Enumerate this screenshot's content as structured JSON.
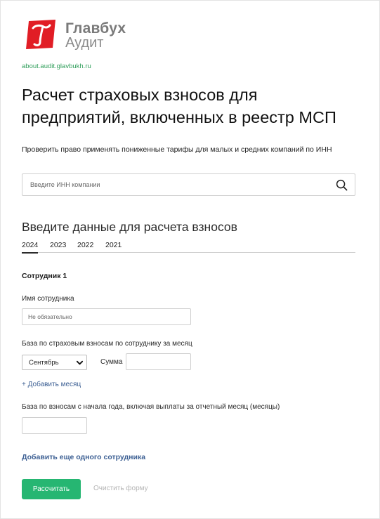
{
  "brand": {
    "name_line1": "Главбух",
    "name_line2": "Аудит",
    "logo_icon": "glavbukh-t-logo",
    "logo_color": "#e11d25"
  },
  "site_link": "about.audit.glavbukh.ru",
  "page_title": "Расчет страховых взносов для предприятий, включенных в реестр МСП",
  "inn_check": {
    "label": "Проверить право применять пониженные тарифы для малых и средних компаний по ИНН",
    "placeholder": "Введите ИНН компании",
    "icon": "search-icon"
  },
  "calc": {
    "section_title": "Введите данные для расчета взносов",
    "years": [
      "2024",
      "2023",
      "2022",
      "2021"
    ],
    "active_year": "2024"
  },
  "employee": {
    "title": "Сотрудник 1",
    "name_label": "Имя сотрудника",
    "name_placeholder": "Не обязательно",
    "base_label": "База по страховым взносам по сотруднику за месяц",
    "month_selected": "Сентябрь",
    "sum_label": "Сумма",
    "add_month": "+ Добавить месяц",
    "ytd_label": "База по взносам с начала года, включая выплаты за отчетный месяц (месяцы)"
  },
  "add_employee": "Добавить еще одного сотрудника",
  "buttons": {
    "calculate": "Рассчитать",
    "clear": "Очистить форму"
  },
  "colors": {
    "accent_green": "#26b672",
    "link_blue": "#3c5f93",
    "site_link_green": "#2f9e5a"
  }
}
